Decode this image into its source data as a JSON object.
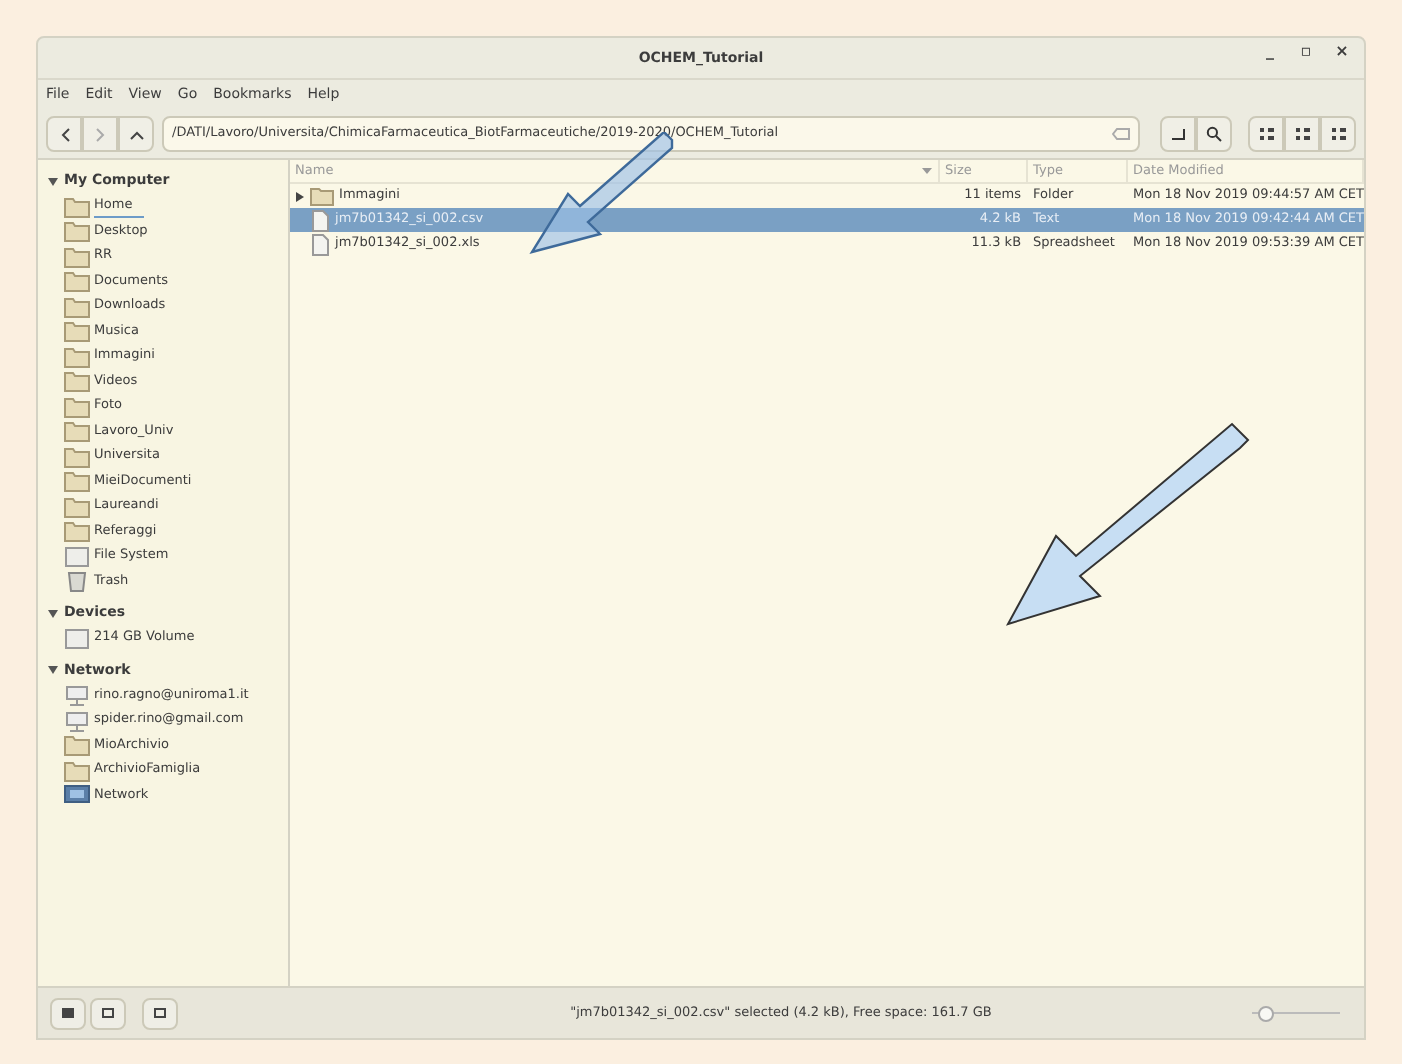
{
  "window": {
    "title": "OCHEM_Tutorial",
    "controls": [
      "_",
      "▫",
      "×"
    ]
  },
  "menu": [
    "File",
    "Edit",
    "View",
    "Go",
    "Bookmarks",
    "Help"
  ],
  "path": "/DATI/Lavoro/Universita/ChimicaFarmaceutica_BiotFarmaceutiche/2019-2020/OCHEM_Tutorial",
  "sidebar": [
    {
      "heading": "My Computer",
      "items": [
        {
          "label": "Home",
          "kind": "folder",
          "focused": true
        },
        {
          "label": "Desktop",
          "kind": "folder",
          "focused": false
        },
        {
          "label": "RR",
          "kind": "folder",
          "focused": false
        },
        {
          "label": "Documents",
          "kind": "folder",
          "focused": false
        },
        {
          "label": "Downloads",
          "kind": "folder",
          "focused": false
        },
        {
          "label": "Musica",
          "kind": "folder",
          "focused": false
        },
        {
          "label": "Immagini",
          "kind": "folder",
          "focused": false
        },
        {
          "label": "Videos",
          "kind": "folder",
          "focused": false
        },
        {
          "label": "Foto",
          "kind": "folder",
          "focused": false
        },
        {
          "label": "Lavoro_Univ",
          "kind": "folder",
          "focused": false
        },
        {
          "label": "Universita",
          "kind": "folder",
          "focused": false
        },
        {
          "label": "MieiDocumenti",
          "kind": "folder",
          "focused": false
        },
        {
          "label": "Laureandi",
          "kind": "folder",
          "focused": false
        },
        {
          "label": "Referaggi",
          "kind": "folder",
          "focused": false
        },
        {
          "label": "File System",
          "kind": "drive",
          "focused": false
        },
        {
          "label": "Trash",
          "kind": "trash",
          "focused": false
        }
      ]
    },
    {
      "heading": "Devices",
      "items": [
        {
          "label": "214 GB Volume",
          "kind": "drive",
          "focused": false
        }
      ]
    },
    {
      "heading": "Network",
      "items": [
        {
          "label": "rino.ragno@uniroma1.it",
          "kind": "share",
          "focused": false
        },
        {
          "label": "spider.rino@gmail.com",
          "kind": "share",
          "focused": false
        },
        {
          "label": "MioArchivio",
          "kind": "folder",
          "focused": false
        },
        {
          "label": "ArchivioFamiglia",
          "kind": "folder",
          "focused": false
        },
        {
          "label": "Network",
          "kind": "network",
          "focused": false
        }
      ]
    }
  ],
  "table": {
    "columns": [
      "Name",
      "Size",
      "Type",
      "Date Modified"
    ],
    "rows": [
      {
        "name": "Immagini",
        "kind": "folder",
        "size": "11 items",
        "type": "Folder",
        "date": "Mon 18 Nov 2019 09:44:57 AM CET",
        "selected": false
      },
      {
        "name": "jm7b01342_si_002.csv",
        "kind": "file",
        "size": "4.2 kB",
        "type": "Text",
        "date": "Mon 18 Nov 2019 09:42:44 AM CET",
        "selected": true
      },
      {
        "name": "jm7b01342_si_002.xls",
        "kind": "file",
        "size": "11.3 kB",
        "type": "Spreadsheet",
        "date": "Mon 18 Nov 2019 09:53:39 AM CET",
        "selected": false
      }
    ]
  },
  "status_bar": {
    "text": "\"jm7b01342_si_002.csv\" selected (4.2 kB), Free space: 161.7 GB",
    "zoom": {
      "level": 0.15
    }
  }
}
